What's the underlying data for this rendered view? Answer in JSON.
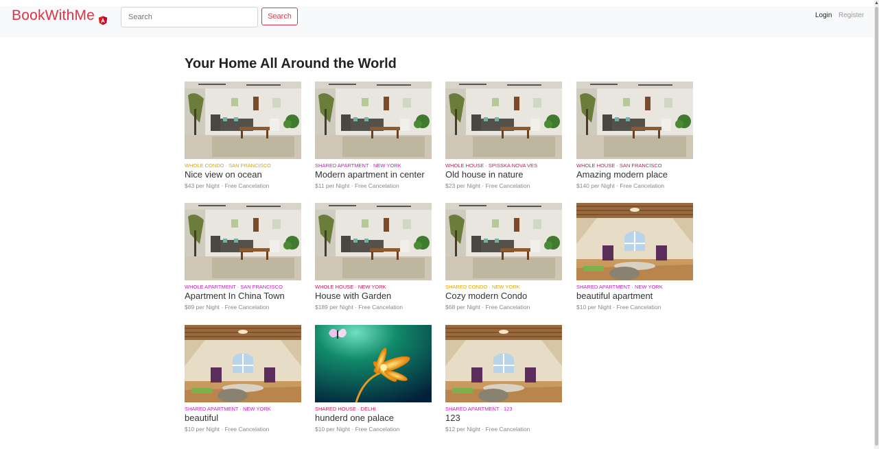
{
  "header": {
    "brand": "BookWithMe",
    "brand_icon": "angular-shield-icon",
    "search_placeholder": "Search",
    "search_button": "Search",
    "login": "Login",
    "register": "Register"
  },
  "main": {
    "title": "Your Home All Around the World",
    "rentals": [
      {
        "tag": "Whole Condo · San Francisco",
        "tag_color": "#d9a600",
        "title": "Nice view on ocean",
        "price": "$43 per Night · Free Cancelation",
        "image": "living-room"
      },
      {
        "tag": "Shared Apartment · New York",
        "tag_color": "#c020c0",
        "title": "Modern apartment in center",
        "price": "$11 per Night · Free Cancelation",
        "image": "living-room"
      },
      {
        "tag": "Whole House · Spisska Nova Ves",
        "tag_color": "#c2185b",
        "title": "Old house in nature",
        "price": "$23 per Night · Free Cancelation",
        "image": "living-room"
      },
      {
        "tag": "Whole House · San Francisco",
        "tag_color": "#c2185b",
        "title": "Amazing modern place",
        "price": "$140 per Night · Free Cancelation",
        "image": "living-room"
      },
      {
        "tag": "Whole Apartment · San Francisco",
        "tag_color": "#c020c0",
        "title": "Apartment In China Town",
        "price": "$89 per Night · Free Cancelation",
        "image": "living-room"
      },
      {
        "tag": "Whole House · New York",
        "tag_color": "#c2185b",
        "title": "House with Garden",
        "price": "$189 per Night · Free Cancelation",
        "image": "living-room"
      },
      {
        "tag": "Shared Condo · New York",
        "tag_color": "#d9a600",
        "title": "Cozy modern Condo",
        "price": "$68 per Night · Free Cancelation",
        "image": "living-room"
      },
      {
        "tag": "Shared Apartment · New York",
        "tag_color": "#c020c0",
        "title": "beautiful apartment",
        "price": "$10 per Night · Free Cancelation",
        "image": "attic-room"
      },
      {
        "tag": "Shared Apartment · New York",
        "tag_color": "#c020c0",
        "title": "beautiful",
        "price": "$10 per Night · Free Cancelation",
        "image": "attic-room"
      },
      {
        "tag": "Shared House · Delhi",
        "tag_color": "#c2185b",
        "title": "hunderd one palace",
        "price": "$10 per Night · Free Cancelation",
        "image": "flower-butterfly"
      },
      {
        "tag": "Shared Apartment · 123",
        "tag_color": "#c020c0",
        "title": "123",
        "price": "$12 per Night · Free Cancelation",
        "image": "attic-room"
      }
    ]
  }
}
